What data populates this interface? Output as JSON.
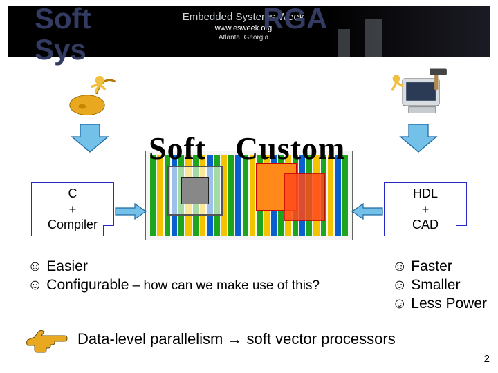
{
  "banner": {
    "line1": "Embedded Systems Week",
    "line2": "www.esweek.org",
    "line3": "Atlanta, Georgia"
  },
  "title_line1": "Soft",
  "title_line2": "Sys",
  "title_suffix": "RGA",
  "labels": {
    "soft": "Soft",
    "custom": "Custom"
  },
  "flow_left": {
    "l1": "C",
    "l2": "+",
    "l3": "Compiler"
  },
  "flow_right": {
    "l1": "HDL",
    "l2": "+",
    "l3": "CAD"
  },
  "benefits_left": [
    {
      "icon": "☺",
      "text": "Easier"
    },
    {
      "icon": "☺",
      "text": "Configurable",
      "suffix": " – how can we make use of this?"
    }
  ],
  "benefits_right": [
    {
      "icon": "☺",
      "text": "Faster"
    },
    {
      "icon": "☺",
      "text": "Smaller"
    },
    {
      "icon": "☺",
      "text": "Less Power"
    }
  ],
  "conclusion": "Data-level parallelism → soft vector processors",
  "slide_number": "2",
  "colors": {
    "arrow": "#73c1e8",
    "arrow_stroke": "#1f6aa5",
    "hand": "#d18a00"
  }
}
